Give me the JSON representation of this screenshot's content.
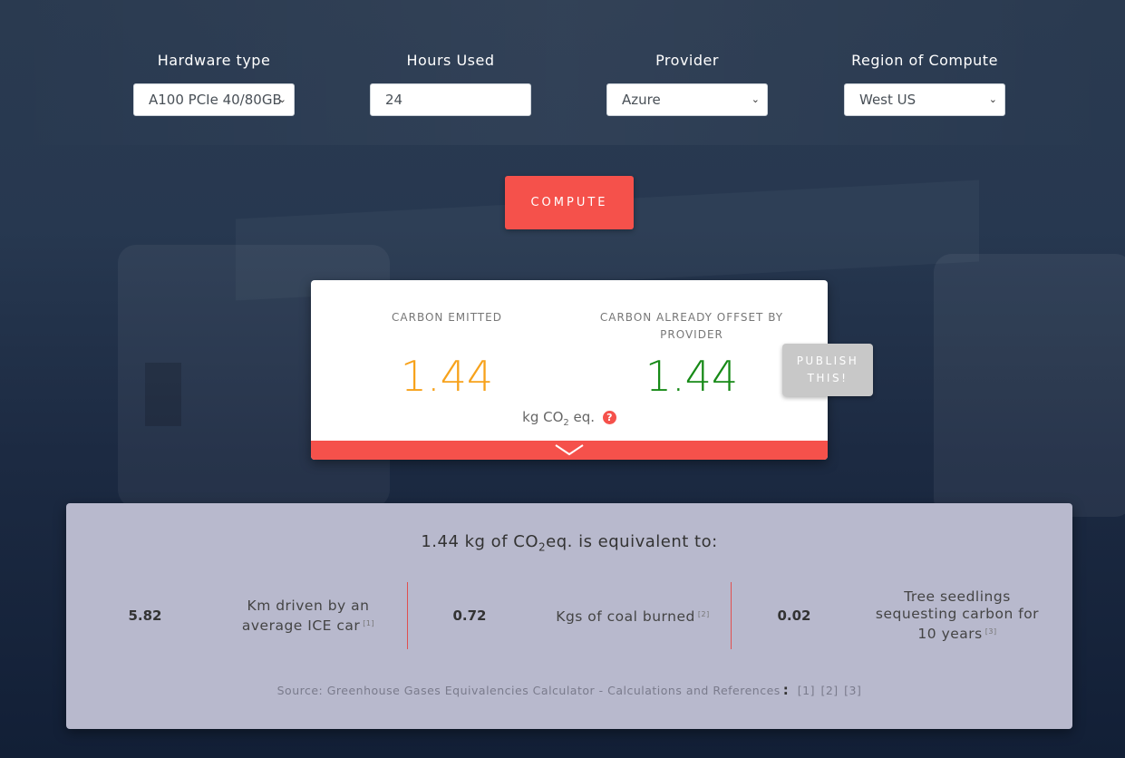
{
  "form": {
    "hardware": {
      "label": "Hardware type",
      "value": "A100 PCIe 40/80GB"
    },
    "hours": {
      "label": "Hours Used",
      "value": "24"
    },
    "provider": {
      "label": "Provider",
      "value": "Azure"
    },
    "region": {
      "label": "Region of Compute",
      "value": "West US"
    },
    "compute_label": "COMPUTE"
  },
  "result": {
    "emitted_title": "CARBON EMITTED",
    "emitted_value": "1.44",
    "offset_title": "CARBON ALREADY OFFSET BY PROVIDER",
    "offset_value": "1.44",
    "unit_prefix": "kg CO",
    "unit_sub": "2",
    "unit_suffix": " eq.",
    "help_glyph": "?",
    "emitted_color": "#f7a21b",
    "offset_color": "#178a17",
    "accent_color": "#f5514b"
  },
  "publish": {
    "label": "PUBLISH THIS!"
  },
  "equivalents": {
    "heading_prefix": "1.44 kg of CO",
    "heading_sub": "2",
    "heading_suffix": "eq. is equivalent to:",
    "items": [
      {
        "value": "5.82",
        "description": "Km driven by an average ICE car",
        "ref": "[1]"
      },
      {
        "value": "0.72",
        "description": "Kgs of coal burned",
        "ref": "[2]"
      },
      {
        "value": "0.02",
        "description": "Tree seedlings sequesting carbon for 10 years",
        "ref": "[3]"
      }
    ],
    "source_text": "Source: Greenhouse Gases Equivalencies Calculator - Calculations and References",
    "source_colon": ":",
    "links": [
      "[1]",
      "[2]",
      "[3]"
    ]
  }
}
